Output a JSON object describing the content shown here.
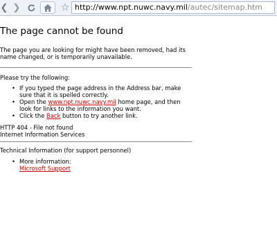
{
  "browser": {
    "url_host": "http://www.npt.nuwc.navy.mil",
    "url_path": "/autec/sitemap.htm",
    "icons": [
      "back-icon",
      "forward-icon",
      "reload-icon",
      "home-icon",
      "bookmark-star-icon"
    ]
  },
  "page": {
    "title": "The page cannot be found",
    "intro": "The page you are looking for might have been removed, had its name changed, or is temporarily unavailable.",
    "try_heading": "Please try the following:",
    "tips": {
      "t1": "If you typed the page address in the Address bar, make sure that it is spelled correctly.",
      "t2_pre": "Open the ",
      "t2_link": "www.npt.nuwc.navy.mil",
      "t2_post": " home page, and then look for links to the information you want.",
      "t3_pre": "Click the ",
      "t3_link": "Back",
      "t3_post": " button to try another link."
    },
    "http_code": "HTTP 404 - File not found",
    "server": "Internet Information Services",
    "tech_heading": "Technical Information (for support personnel)",
    "more_info": "More information:",
    "ms_support": "Microsoft Support"
  },
  "colors": {
    "link": "#cc0000",
    "toolbar": "#eef2f7"
  }
}
